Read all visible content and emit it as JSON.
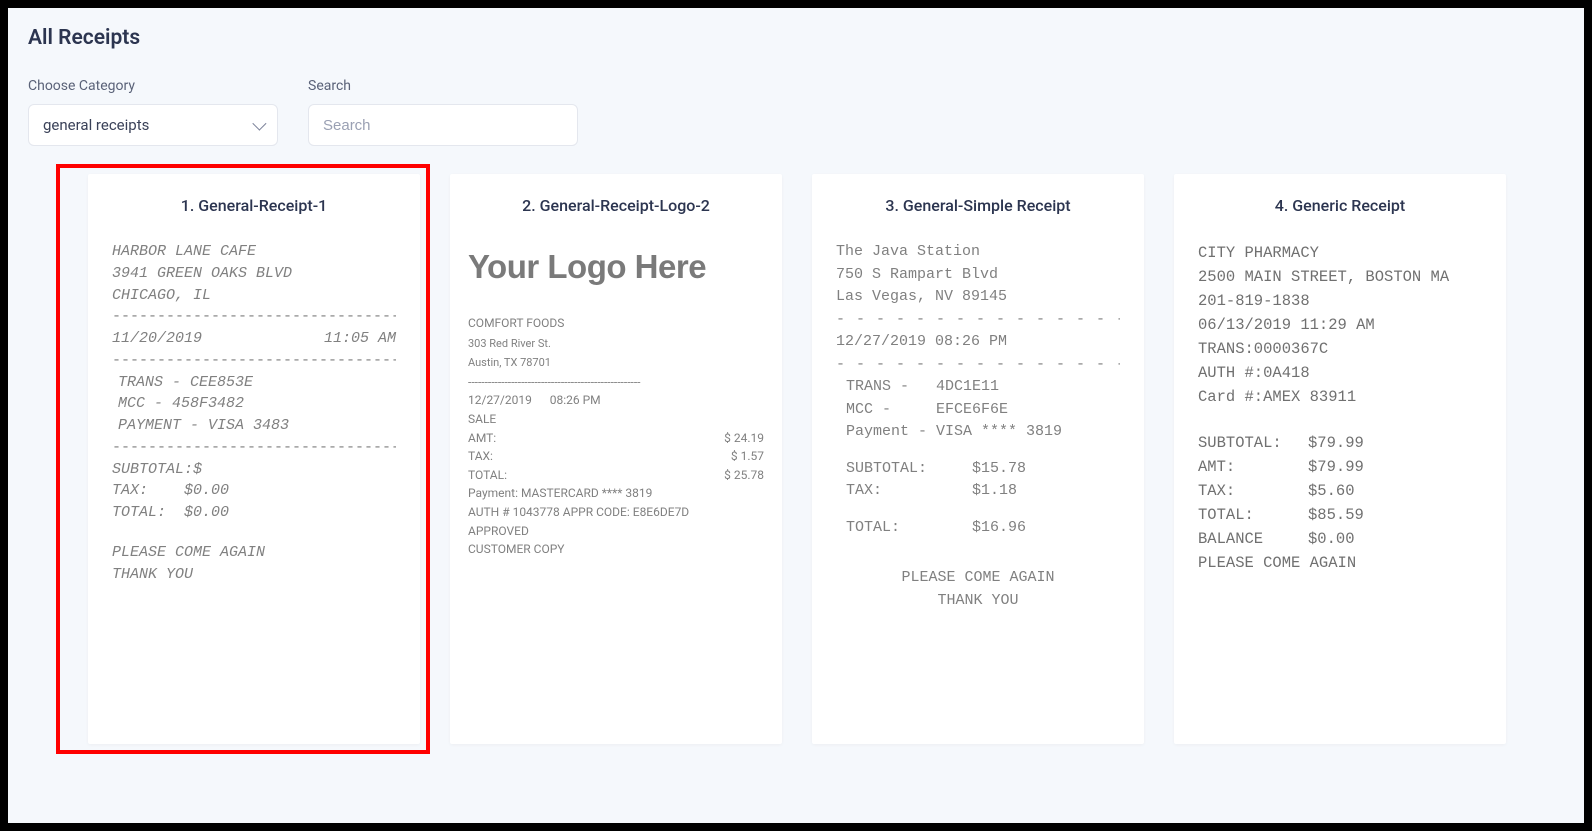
{
  "page_title": "All Receipts",
  "controls": {
    "category_label": "Choose Category",
    "category_value": "general receipts",
    "search_label": "Search",
    "search_placeholder": "Search"
  },
  "cards": [
    {
      "title": "1. General-Receipt-1",
      "highlighted": true
    },
    {
      "title": "2. General-Receipt-Logo-2"
    },
    {
      "title": "3. General-Simple Receipt"
    },
    {
      "title": "4. Generic Receipt"
    }
  ],
  "receipt1": {
    "store": "HARBOR LANE CAFE",
    "addr1": "3941 GREEN OAKS BLVD",
    "addr2": "CHICAGO, IL",
    "date": "11/20/2019",
    "time": "11:05 AM",
    "trans": "TRANS - CEE853E",
    "mcc": "MCC - 458F3482",
    "payment": "PAYMENT - VISA 3483",
    "subtotal_label": "SUBTOTAL:$",
    "tax_label": "TAX:",
    "tax_value": "$0.00",
    "total_label": "TOTAL:",
    "total_value": "$0.00",
    "msg1": "PLEASE COME AGAIN",
    "msg2": "THANK YOU",
    "dashes": "---------------------------------"
  },
  "receipt2": {
    "logo": "Your Logo Here",
    "name": "COMFORT FOODS",
    "addr1": "303 Red River St.",
    "addr2": "Austin, TX 78701",
    "date": "12/27/2019",
    "time": "08:26 PM",
    "sale": "SALE",
    "amt_label": "AMT:",
    "amt_value": "$ 24.19",
    "tax_label": "TAX:",
    "tax_value": "$ 1.57",
    "total_label": "TOTAL:",
    "total_value": "$ 25.78",
    "payment": "Payment: MASTERCARD **** 3819",
    "auth": "AUTH # 1043778    APPR CODE: E8E6DE7D",
    "approved": "APPROVED",
    "copy": "CUSTOMER COPY",
    "dashes": "----------------------------------------------------"
  },
  "receipt3": {
    "store": "The Java Station",
    "addr1": "750 S Rampart Blvd",
    "addr2": "Las Vegas, NV 89145",
    "datetime": "12/27/2019 08:26 PM",
    "trans": "TRANS -   4DC1E11",
    "mcc": "MCC -     EFCE6F6E",
    "payment": "Payment - VISA **** 3819",
    "subtotal_line": "SUBTOTAL:     $15.78",
    "tax_line": "TAX:          $1.18",
    "total_line": "TOTAL:        $16.96",
    "msg1": "PLEASE COME AGAIN",
    "msg2": "THANK YOU",
    "dashes": "- - - - - - - - - - - - - - - -"
  },
  "receipt4": {
    "store": "CITY PHARMACY",
    "addr": "2500 MAIN STREET, BOSTON MA",
    "phone": "201-819-1838",
    "datetime": "06/13/2019 11:29 AM",
    "trans": "TRANS:0000367C",
    "auth": "AUTH #:0A418",
    "card": "Card #:AMEX 83911",
    "subtotal_k": "SUBTOTAL:",
    "subtotal_v": "$79.99",
    "amt_k": "AMT:",
    "amt_v": "$79.99",
    "tax_k": "TAX:",
    "tax_v": "$5.60",
    "total_k": "TOTAL:",
    "total_v": "$85.59",
    "balance_k": "BALANCE",
    "balance_v": "$0.00",
    "msg": "PLEASE COME AGAIN"
  }
}
